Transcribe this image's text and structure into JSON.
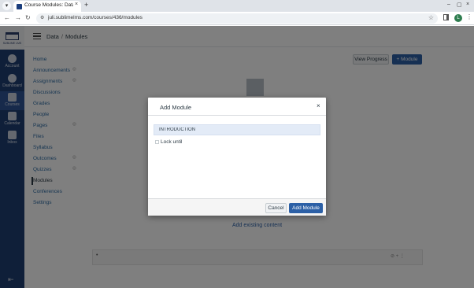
{
  "browser": {
    "tab_title": "Course Modules: Data A",
    "tab_close": "×",
    "new_tab": "+",
    "url": "juli.sublimelms.com/courses/436/modules",
    "profile_initial": "L",
    "window_controls": [
      "–",
      "▢",
      "×"
    ]
  },
  "logo": {
    "text": "SUBLIME LMS"
  },
  "global_nav": {
    "items": [
      {
        "label": "Account",
        "icon": "account-icon"
      },
      {
        "label": "Dashboard",
        "icon": "dashboard-icon"
      },
      {
        "label": "Courses",
        "icon": "courses-icon",
        "active": true
      },
      {
        "label": "Calendar",
        "icon": "calendar-icon"
      },
      {
        "label": "Inbox",
        "icon": "inbox-icon"
      }
    ]
  },
  "header": {
    "breadcrumb": [
      "Data",
      "Modules"
    ],
    "separator": "/"
  },
  "course_nav": {
    "items": [
      {
        "label": "Home"
      },
      {
        "label": "Announcements",
        "hidden_icon": true
      },
      {
        "label": "Assignments",
        "hidden_icon": true
      },
      {
        "label": "Discussions"
      },
      {
        "label": "Grades"
      },
      {
        "label": "People"
      },
      {
        "label": "Pages",
        "hidden_icon": true
      },
      {
        "label": "Files"
      },
      {
        "label": "Syllabus"
      },
      {
        "label": "Outcomes",
        "hidden_icon": true
      },
      {
        "label": "Quizzes",
        "hidden_icon": true
      },
      {
        "label": "Modules",
        "active": true
      },
      {
        "label": "Conferences"
      },
      {
        "label": "Settings"
      }
    ]
  },
  "content": {
    "view_progress_label": "View Progress",
    "add_module_label": "+ Module",
    "add_existing_label": "Add existing content",
    "module_row_bullet": "•",
    "module_row_icons": "⊘  +  ⋮"
  },
  "modal": {
    "title": "Add Module",
    "close": "×",
    "module_name_value": "INTRODUCTION",
    "lock_label": "Lock until",
    "cancel_label": "Cancel",
    "submit_label": "Add Module"
  },
  "colors": {
    "global_nav_bg": "#1f3f72",
    "primary_button": "#2c60a6",
    "link": "#2d6ba3",
    "overlay": "rgba(0,0,0,0.5)"
  }
}
